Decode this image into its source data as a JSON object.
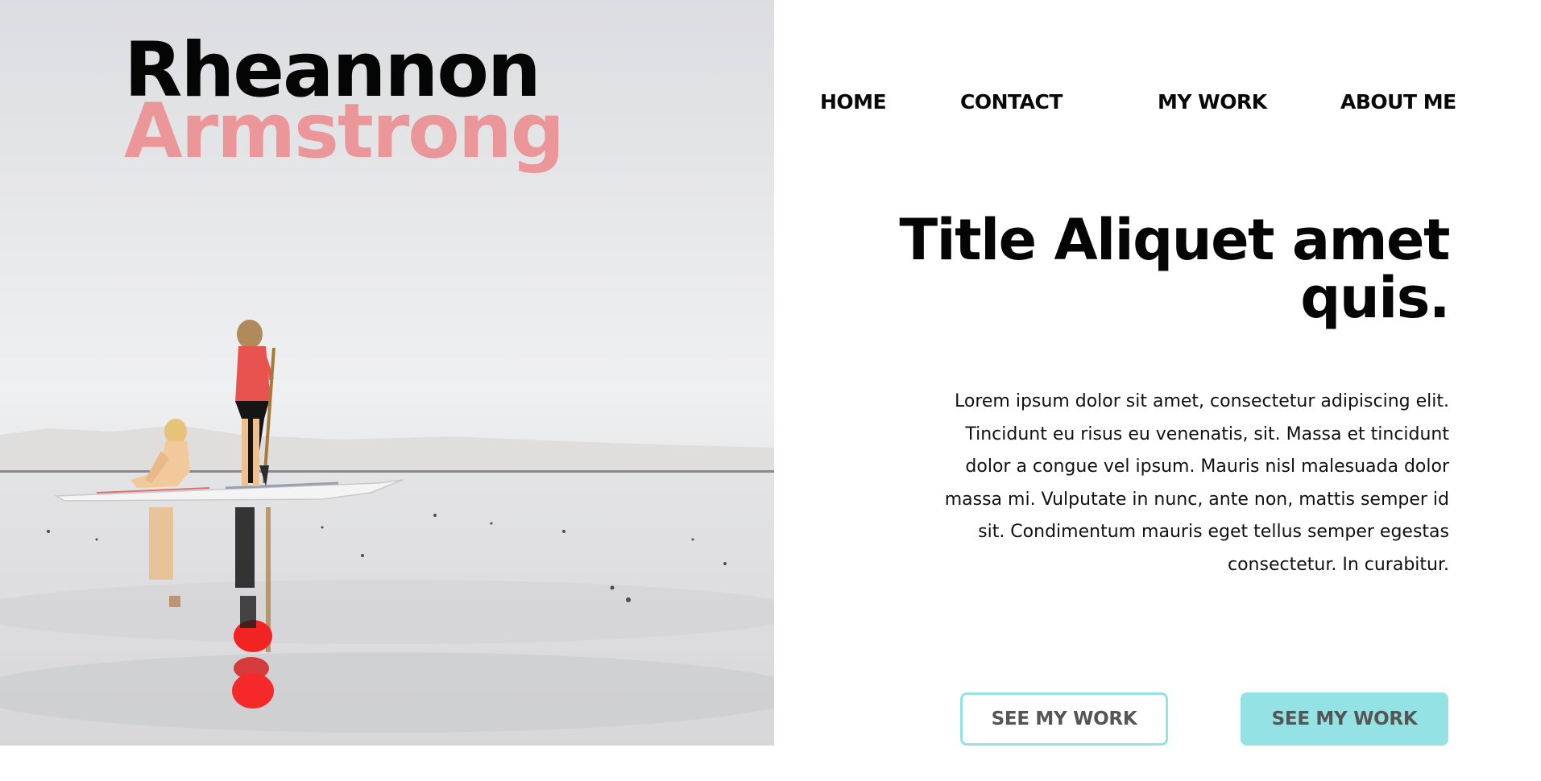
{
  "brand": {
    "first_name": "Rheannon",
    "last_name": "Armstrong"
  },
  "nav": {
    "items": [
      "HOME",
      "CONTACT",
      "MY WORK",
      "ABOUT ME"
    ]
  },
  "main": {
    "title": "Title Aliquet amet quis.",
    "body": "Lorem ipsum dolor sit amet, consectetur adipiscing elit. Tincidunt eu risus eu venenatis, sit. Massa et tincidunt dolor a congue vel ipsum. Mauris nisl malesuada dolor massa mi. Vulputate in nunc, ante non, mattis semper id sit. Condimentum mauris eget tellus semper egestas consectetur. In curabitur."
  },
  "buttons": {
    "primary_label": "SEE MY WORK",
    "secondary_label": "SEE MY WORK"
  },
  "colors": {
    "accent": "#95e2e4",
    "brand_secondary": "#eb9699",
    "text": "#050505"
  },
  "hero_image": {
    "subject": "paddleboard-children-photo"
  }
}
